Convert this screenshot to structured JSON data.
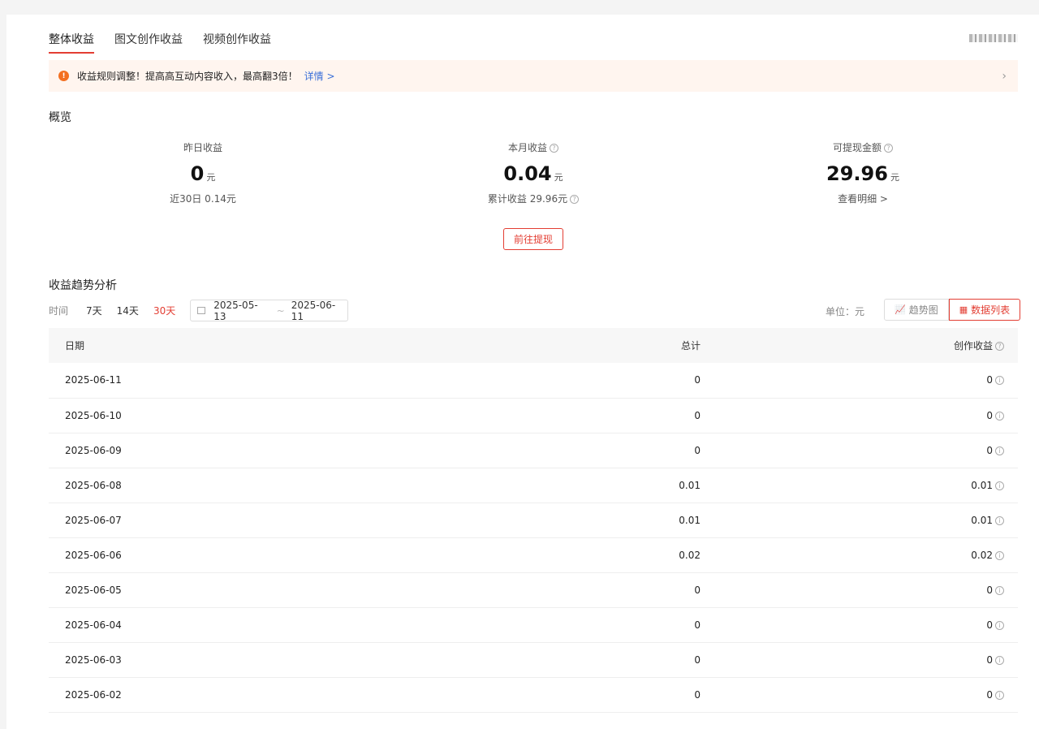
{
  "tabs": [
    "整体收益",
    "图文创作收益",
    "视频创作收益"
  ],
  "notice": {
    "text": "收益规则调整！提高高互动内容收入，最高翻3倍！",
    "link": "详情 >"
  },
  "overview": {
    "title": "概览",
    "yesterday": {
      "label": "昨日收益",
      "value": "0",
      "unit": "元",
      "sub": "近30日 0.14元"
    },
    "month": {
      "label": "本月收益",
      "value": "0.04",
      "unit": "元",
      "sub": "累计收益 29.96元"
    },
    "withdrawable": {
      "label": "可提现金额",
      "value": "29.96",
      "unit": "元",
      "sub": "查看明细 >"
    },
    "withdraw_button": "前往提现"
  },
  "trend": {
    "title": "收益趋势分析",
    "time_label": "时间",
    "ranges": [
      "7天",
      "14天",
      "30天"
    ],
    "date_start": "2025-05-13",
    "date_end": "2025-06-11",
    "unit": "单位：元",
    "view_chart": "趋势图",
    "view_table": "数据列表"
  },
  "table": {
    "headers": [
      "日期",
      "总计",
      "创作收益"
    ],
    "rows": [
      [
        "2025-06-11",
        "0",
        "0"
      ],
      [
        "2025-06-10",
        "0",
        "0"
      ],
      [
        "2025-06-09",
        "0",
        "0"
      ],
      [
        "2025-06-08",
        "0.01",
        "0.01"
      ],
      [
        "2025-06-07",
        "0.01",
        "0.01"
      ],
      [
        "2025-06-06",
        "0.02",
        "0.02"
      ],
      [
        "2025-06-05",
        "0",
        "0"
      ],
      [
        "2025-06-04",
        "0",
        "0"
      ],
      [
        "2025-06-03",
        "0",
        "0"
      ],
      [
        "2025-06-02",
        "0",
        "0"
      ]
    ]
  },
  "colors": {
    "accent": "#e33e33",
    "notice_bg": "#fff5ef",
    "notice_icon": "#f37021",
    "link": "#3a6fd8"
  }
}
